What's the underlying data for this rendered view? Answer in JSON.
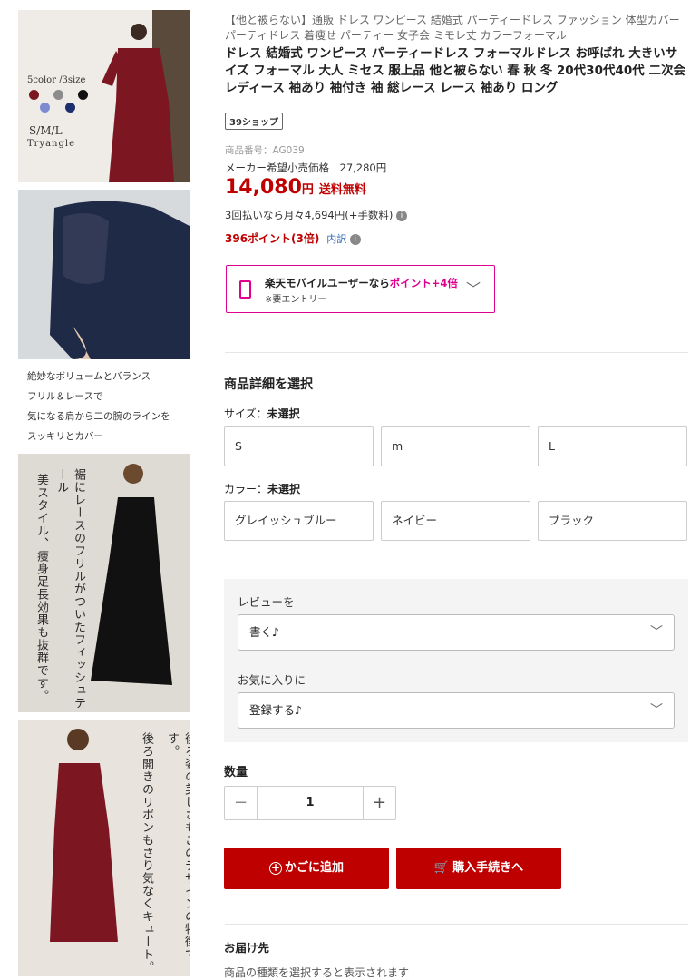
{
  "images": {
    "img1": {
      "colors_label": "5color /3size",
      "sizes_label": "S/M/L",
      "brand": "Tryangle",
      "swatches": [
        "#7c1722",
        "#8c8c8c",
        "#111111",
        "#7d8bd0",
        "#1c2e6e"
      ]
    },
    "caption_lines": [
      "絶妙なボリュームとバランス",
      "フリル＆レースで",
      "気になる肩から二の腕のラインを",
      "スッキリとカバー"
    ],
    "img3": {
      "vertical_a": "裾にレースのフリルがついたフィッシュテール",
      "vertical_b": "美スタイル、痩身足長効果も抜群です。"
    },
    "img4": {
      "vertical_a": "後ろ姿の美しさもこのデザインの特徴です。",
      "vertical_b": "後ろ開きのリボンもさり気なくキュート。"
    }
  },
  "product": {
    "subtitle": "【他と被らない】通販 ドレス ワンピース 結婚式 パーティードレス ファッション 体型カバー パーティドレス 着痩せ パーティー 女子会 ミモレ丈 カラーフォーマル",
    "title": "ドレス 結婚式 ワンピース パーティードレス フォーマルドレス お呼ばれ 大きいサイズ フォーマル 大人 ミセス 服上品 他と被らない 春 秋 冬 20代30代40代 二次会 レディース 袖あり 袖付き 袖 総レース レース 袖あり ロング",
    "shop_badge": "39ショップ",
    "sku": "商品番号：AG039",
    "msrp": "メーカー希望小売価格　27,280円",
    "price": "14,080",
    "yen": "円",
    "shipping": "送料無料",
    "installment": "3回払いなら月々4,694円(+手数料)",
    "points": "396ポイント(3倍)",
    "points_detail": "内訳"
  },
  "mobile_promo": {
    "text_before": "楽天モバイルユーザーなら",
    "text_pink": "ポイント+4倍",
    "sub": "※要エントリー"
  },
  "options": {
    "section_title": "商品詳細を選択",
    "size_label": "サイズ：",
    "size_status": "未選択",
    "sizes": [
      "S",
      "m",
      "L"
    ],
    "color_label": "カラー：",
    "color_status": "未選択",
    "colors": [
      "グレイッシュブルー",
      "ネイビー",
      "ブラック"
    ]
  },
  "review": {
    "label": "レビューを",
    "value": "書く♪"
  },
  "favorite": {
    "label": "お気に入りに",
    "value": "登録する♪"
  },
  "quantity": {
    "label": "数量",
    "value": "1"
  },
  "buttons": {
    "cart": "かごに追加",
    "buy": "購入手続きへ"
  },
  "delivery": {
    "title": "お届け先",
    "note": "商品の種類を選択すると表示されます"
  }
}
